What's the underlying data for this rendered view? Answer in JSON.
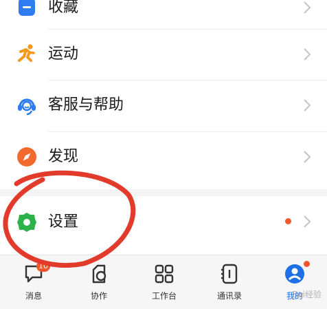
{
  "menu": {
    "items": [
      {
        "label": "收藏",
        "icon": "bookmark-icon",
        "color": "#2f7bf0"
      },
      {
        "label": "运动",
        "icon": "running-icon",
        "color": "#f39a1e"
      },
      {
        "label": "客服与帮助",
        "icon": "headset-icon",
        "color": "#2f7bf0"
      },
      {
        "label": "发现",
        "icon": "compass-icon",
        "color": "#f26a2e"
      },
      {
        "label": "设置",
        "icon": "gear-icon",
        "color": "#2cb24a",
        "has_dot": true
      }
    ]
  },
  "tabbar": {
    "tabs": [
      {
        "label": "消息",
        "icon": "message-icon",
        "badge": "10"
      },
      {
        "label": "协作",
        "icon": "collaboration-icon"
      },
      {
        "label": "工作台",
        "icon": "workbench-icon"
      },
      {
        "label": "通讯录",
        "icon": "contacts-icon"
      },
      {
        "label": "我的",
        "icon": "profile-icon",
        "active": true,
        "has_dot": true
      }
    ]
  },
  "watermark": {
    "text": "Bai经验"
  },
  "colors": {
    "accent": "#1f6fe5",
    "badge": "#f2542d",
    "annotation": "#e23b2c"
  }
}
